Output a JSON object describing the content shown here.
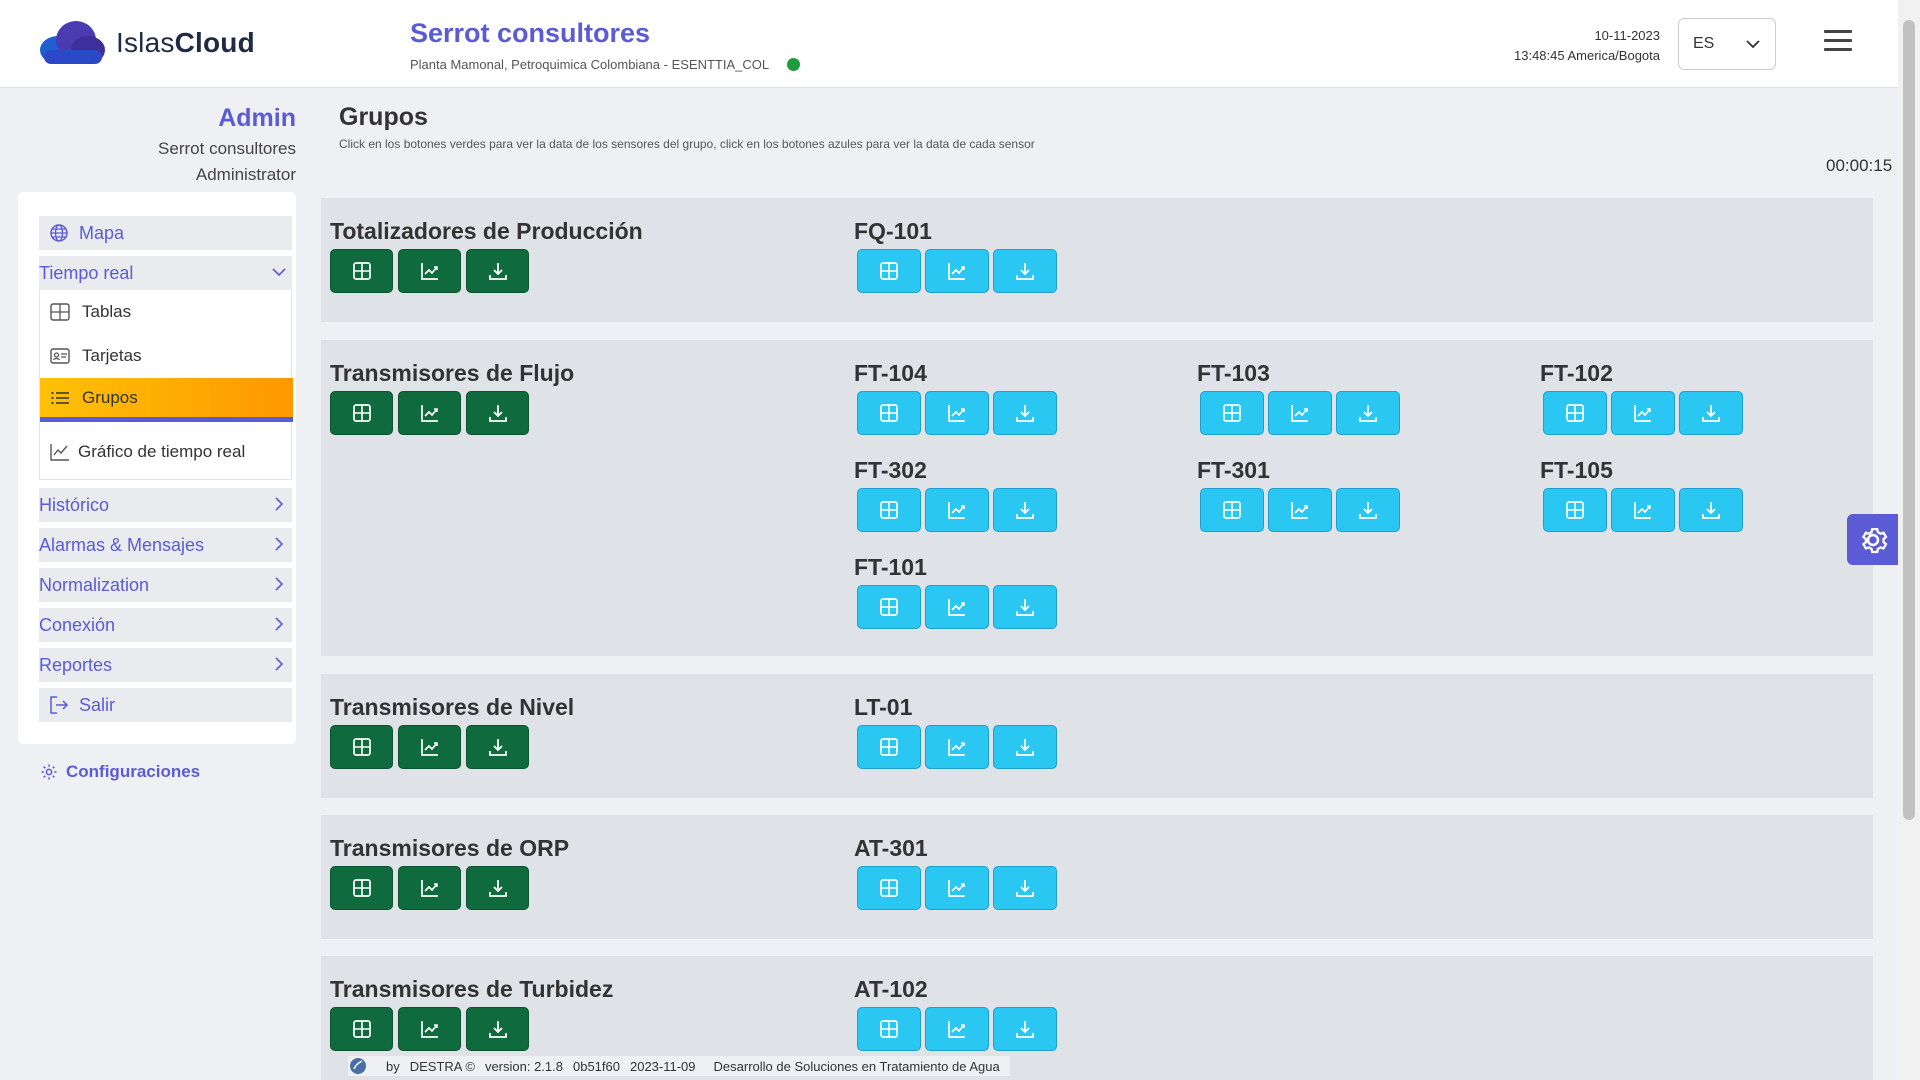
{
  "header": {
    "logo_text_plain": "Islas",
    "logo_text_bold": "Cloud",
    "company_name": "Serrot consultores",
    "site": "Planta Mamonal, Petroquimica Colombiana - ESENTTIA_COL",
    "date": "10-11-2023",
    "time": "13:48:45 America/Bogota",
    "language": "ES"
  },
  "user": {
    "role": "Admin",
    "company": "Serrot consultores",
    "title": "Administrator"
  },
  "sidebar": {
    "items": [
      {
        "label": "Mapa",
        "icon": "globe-icon"
      },
      {
        "label": "Tiempo real",
        "icon": "chevron-down-icon"
      },
      {
        "label": "Histórico",
        "icon": "chevron-right-icon"
      },
      {
        "label": "Alarmas & Mensajes",
        "icon": "chevron-right-icon"
      },
      {
        "label": "Normalization",
        "icon": "chevron-right-icon"
      },
      {
        "label": "Conexión",
        "icon": "chevron-right-icon"
      },
      {
        "label": "Reportes",
        "icon": "chevron-right-icon"
      },
      {
        "label": "Salir",
        "icon": "logout-icon"
      }
    ],
    "sub_items": [
      {
        "label": "Tablas",
        "icon": "table-icon"
      },
      {
        "label": "Tarjetas",
        "icon": "card-icon"
      },
      {
        "label": "Grupos",
        "icon": "list-icon",
        "active": true
      },
      {
        "label": "Gráfico de tiempo real",
        "icon": "chart-icon"
      }
    ],
    "config_label": "Configuraciones"
  },
  "main": {
    "title": "Grupos",
    "subtitle": "Click en los botones verdes para ver la data de los sensores del grupo, click en los botones azules para ver la data de cada sensor",
    "timer": "00:00:15",
    "groups": [
      {
        "name": "Totalizadores de Producción",
        "sensors": [
          "FQ-101"
        ]
      },
      {
        "name": "Transmisores de Flujo",
        "sensors": [
          "FT-104",
          "FT-103",
          "FT-102",
          "FT-302",
          "FT-301",
          "FT-105",
          "FT-101"
        ]
      },
      {
        "name": "Transmisores de Nivel",
        "sensors": [
          "LT-01"
        ]
      },
      {
        "name": "Transmisores de ORP",
        "sensors": [
          "AT-301"
        ]
      },
      {
        "name": "Transmisores de Turbidez",
        "sensors": [
          "AT-102"
        ]
      }
    ]
  },
  "footer": {
    "by": "by",
    "brand": "DESTRA ©",
    "version": "version: 2.1.8",
    "commit": "0b51f60",
    "date": "2023-11-09",
    "tagline": "Desarrollo de Soluciones en Tratamiento de Agua"
  },
  "colors": {
    "accent": "#5b5bd6",
    "group_button": "#0f6b3e",
    "sensor_button": "#29c7f2",
    "active_item": "#ff9800",
    "status_online": "#1e9b3a"
  }
}
